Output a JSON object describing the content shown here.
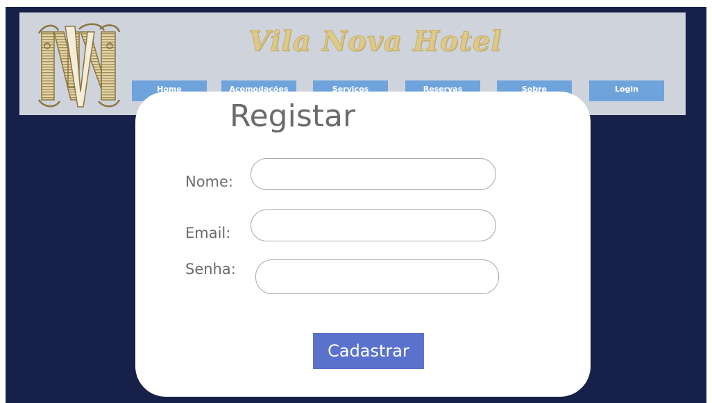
{
  "header": {
    "title": "Vila Nova Hotel",
    "logo_icon": "vn-monogram-logo",
    "nav": [
      {
        "label": "Home"
      },
      {
        "label": "Acomodações"
      },
      {
        "label": "Serviços"
      },
      {
        "label": "Reservas"
      },
      {
        "label": "Sobre"
      },
      {
        "label": "Login"
      }
    ]
  },
  "form": {
    "title": "Registar",
    "fields": [
      {
        "label": "Nome:",
        "value": "",
        "placeholder": ""
      },
      {
        "label": "Email:",
        "value": "",
        "placeholder": ""
      },
      {
        "label": "Senha:",
        "value": "",
        "placeholder": ""
      }
    ],
    "submit_label": "Cadastrar"
  },
  "colors": {
    "background": "#162048",
    "header_bg": "#cfd3dc",
    "nav_button": "#6fa3dc",
    "title_gold": "#ddc98a",
    "submit_button": "#5a72cc"
  }
}
